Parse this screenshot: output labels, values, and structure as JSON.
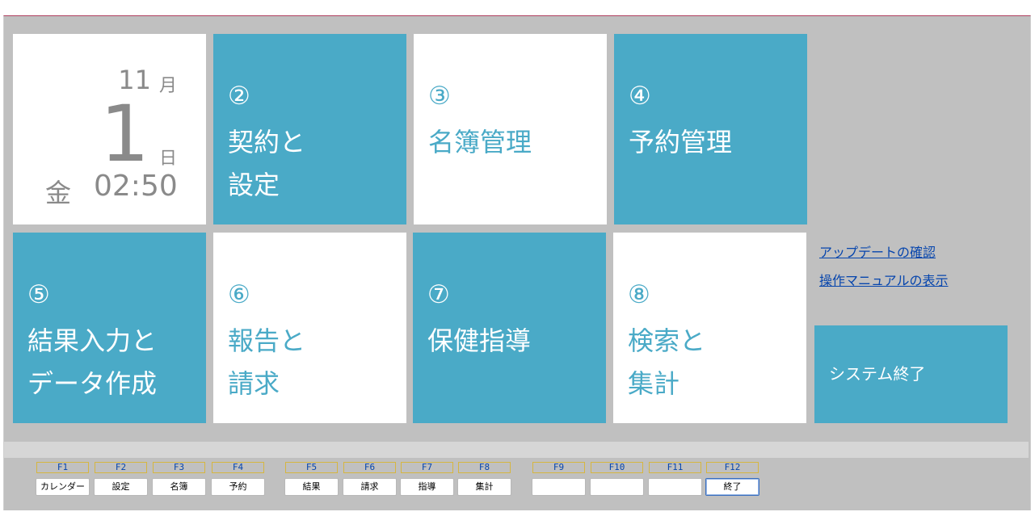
{
  "clock": {
    "month": "11",
    "month_label": "月",
    "day": "1",
    "day_label": "日",
    "weekday": "金",
    "time": "02:50"
  },
  "tiles": [
    {
      "num": "②",
      "label": "契約と\n設定"
    },
    {
      "num": "③",
      "label": "名簿管理"
    },
    {
      "num": "④",
      "label": "予約管理"
    },
    {
      "num": "⑤",
      "label": "結果入力と\nデータ作成"
    },
    {
      "num": "⑥",
      "label": "報告と\n請求"
    },
    {
      "num": "⑦",
      "label": "保健指導"
    },
    {
      "num": "⑧",
      "label": "検索と\n集計"
    }
  ],
  "links": {
    "update": "アップデートの確認",
    "manual": "操作マニュアルの表示"
  },
  "exit_tile": {
    "label": "システム終了"
  },
  "fkeys": [
    {
      "key": "F1",
      "label": "カレンダー"
    },
    {
      "key": "F2",
      "label": "設定"
    },
    {
      "key": "F3",
      "label": "名簿"
    },
    {
      "key": "F4",
      "label": "予約"
    },
    {
      "key": "F5",
      "label": "結果"
    },
    {
      "key": "F6",
      "label": "請求"
    },
    {
      "key": "F7",
      "label": "指導"
    },
    {
      "key": "F8",
      "label": "集計"
    },
    {
      "key": "F9",
      "label": ""
    },
    {
      "key": "F10",
      "label": ""
    },
    {
      "key": "F11",
      "label": ""
    },
    {
      "key": "F12",
      "label": "終了"
    }
  ],
  "colors": {
    "tile_blue": "#4aaac7",
    "background": "#c0c0c0"
  }
}
